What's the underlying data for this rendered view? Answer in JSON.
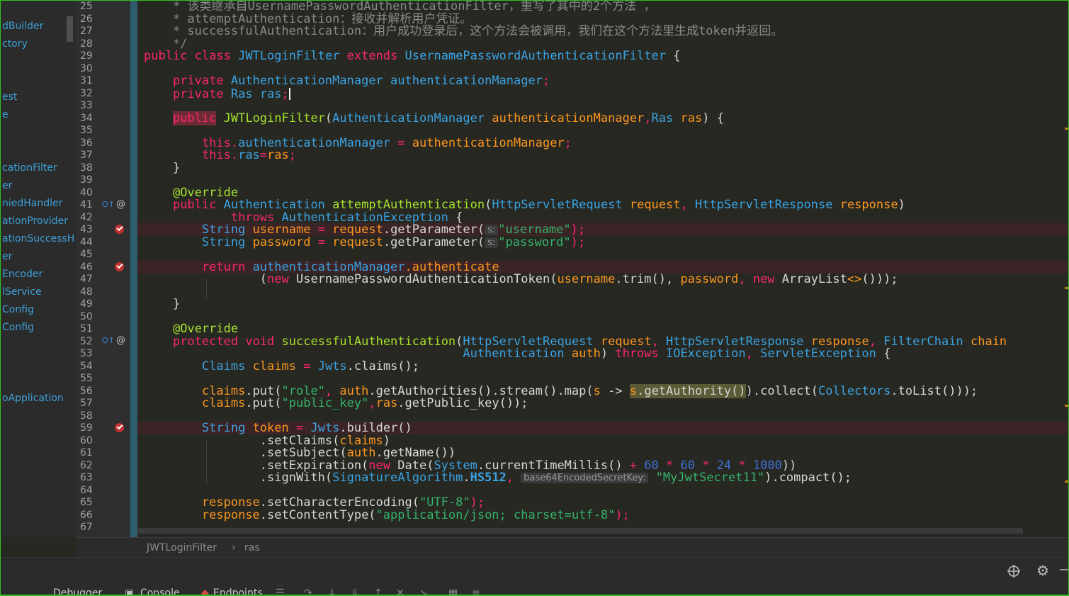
{
  "sidebar": {
    "items": [
      "dBuilder",
      "ctory",
      "est",
      "e",
      "cationFilter",
      "er",
      "niedHandler",
      "ationProvider",
      "ationSuccessH",
      "er",
      "Encoder",
      "lService",
      "Config",
      "Config",
      "oApplication"
    ]
  },
  "gutter": {
    "line_numbers": [
      "25",
      "26",
      "27",
      "28",
      "29",
      "30",
      "31",
      "32",
      "33",
      "34",
      "35",
      "36",
      "37",
      "38",
      "39",
      "40",
      "41",
      "42",
      "43",
      "44",
      "45",
      "46",
      "47",
      "48",
      "49",
      "50",
      "51",
      "52",
      "53",
      "54",
      "55",
      "56",
      "57",
      "58",
      "59",
      "60",
      "61",
      "62",
      "63",
      "64",
      "65",
      "66",
      "67"
    ],
    "icons": [
      "override-icon",
      "annotation-icon",
      "breakpoint-icon",
      "fold-icon"
    ]
  },
  "code": {
    "l25": {
      "a": "*",
      "b": " 该类继承自UsernamePasswordAuthenticationFilter，重写了其中的2个方法 ，"
    },
    "l26": {
      "a": "*",
      "b": " attemptAuthentication：接收并解析用户凭证。"
    },
    "l27": {
      "a": "*",
      "b": " successfulAuthentication：用户成功登录后，这个方法会被调用，我们在这个方法里生成token并返回。"
    },
    "l28": {
      "a": "*/"
    },
    "l29": {
      "a": "public class",
      "b": "JWTLoginFilter",
      "c": "extends",
      "d": "UsernamePasswordAuthenticationFilter",
      "e": "{"
    },
    "l31": {
      "a": "private",
      "b": "AuthenticationManager",
      "c": "authenticationManager",
      "d": ";"
    },
    "l32": {
      "a": "private",
      "b": "Ras",
      "c": "ras",
      "d": ";"
    },
    "l34": {
      "a": "public",
      "b": "JWTLoginFilter",
      "c": "(",
      "d": "AuthenticationManager",
      "e": "authenticationManager",
      "f": ",",
      "g": "Ras",
      "h": "ras",
      "i": ") {"
    },
    "l36": {
      "a": "this.",
      "b": "authenticationManager",
      "c": " = ",
      "d": "authenticationManager",
      "e": ";"
    },
    "l37": {
      "a": "this.",
      "b": "ras",
      "c": "=",
      "d": "ras",
      "e": ";"
    },
    "l38": {
      "a": "}"
    },
    "l40": {
      "a": "@Override"
    },
    "l41": {
      "a": "public",
      "b": "Authentication",
      "c": "attemptAuthentication",
      "d": "(",
      "e": "HttpServletRequest",
      "f": "request",
      "g": ", ",
      "h": "HttpServletResponse",
      "i": "response",
      "j": ")"
    },
    "l42": {
      "a": "throws",
      "b": "AuthenticationException",
      "c": " {"
    },
    "l43": {
      "a": "String",
      "b": "username",
      "c": " = ",
      "d": "request",
      "e": ".getParameter(",
      "hint": "s:",
      "f": "\"username\"",
      "g": ");"
    },
    "l44": {
      "a": "String",
      "b": "password",
      "c": " = ",
      "d": "request",
      "e": ".getParameter(",
      "hint": "s:",
      "f": "\"password\"",
      "g": ");"
    },
    "l46": {
      "a": "return",
      "b": "authenticationManager",
      "c": ".authenticate"
    },
    "l47": {
      "a": "(",
      "b": "new",
      "c": " UsernamePasswordAuthenticationToken(",
      "d": "username",
      "e": ".trim(), ",
      "f": "password",
      "g": ", ",
      "h": "new",
      "i": " ArrayList",
      "j": "<>",
      "k": "()));"
    },
    "l49": {
      "a": "}"
    },
    "l51": {
      "a": "@Override"
    },
    "l52": {
      "a": "protected",
      "b": "void",
      "c": "successfulAuthentication",
      "d": "(",
      "e": "HttpServletRequest",
      "f": "request",
      "g": ", ",
      "h": "HttpServletResponse",
      "i": "response",
      "j": ", ",
      "k": "FilterChain",
      "l": "chain"
    },
    "l53": {
      "a": "Authentication",
      "b": "auth",
      "c": ") ",
      "d": "throws",
      "e": "IOException",
      "f": ", ",
      "g": "ServletException",
      "h": " {"
    },
    "l54": {
      "a": "Claims",
      "b": "claims",
      "c": " = ",
      "d": "Jwts",
      "e": ".claims();"
    },
    "l56": {
      "a": "claims",
      "b": ".put(",
      "c": "\"role\"",
      "d": ", ",
      "e": "auth",
      "f": ".getAuthorities().stream().map(",
      "g": "s",
      "h": " -> ",
      "i": "s",
      "j": ".getAuthority()",
      "k": ").collect(",
      "l": "Collectors",
      "m": ".toList()));"
    },
    "l57": {
      "a": "claims",
      "b": ".put(",
      "c": "\"public_key\"",
      "d": ",",
      "e": "ras",
      "f": ".getPublic_key());"
    },
    "l59": {
      "a": "String",
      "b": "token",
      "c": " = ",
      "d": "Jwts",
      "e": ".builder()"
    },
    "l60": {
      "a": ".setClaims(",
      "b": "claims",
      "c": ")"
    },
    "l61": {
      "a": ".setSubject(",
      "b": "auth",
      "c": ".getName())"
    },
    "l62": {
      "a": ".setExpiration(",
      "b": "new",
      "c": " Date(",
      "d": "System",
      "e": ".currentTimeMillis() ",
      "f": "+",
      "g": " 60 ",
      "h": "*",
      "i": " 60 ",
      "j": "*",
      "k": " 24 ",
      "l": "*",
      "m": " 1000",
      "n": "))"
    },
    "l63": {
      "a": ".signWith(",
      "b": "SignatureAlgorithm",
      "c": ".",
      "d": "HS512",
      "e": ", ",
      "hint": "base64EncodedSecretKey:",
      "f": "\"MyJwtSecret11\"",
      "g": ").compact();"
    },
    "l65": {
      "a": "response",
      "b": ".setCharacterEncoding(",
      "c": "\"UTF-8\"",
      "d": ");"
    },
    "l66": {
      "a": "response",
      "b": ".setContentType(",
      "c": "\"application/json; charset=utf-8\"",
      "d": ");"
    }
  },
  "breadcrumb": {
    "class": "JWTLoginFilter",
    "sep": "›",
    "field": "ras"
  },
  "bottom": {
    "tabs": [
      "Debugger",
      "Console",
      "Endpoints"
    ],
    "icons": [
      "list-icon",
      "step-over-icon",
      "step-into-icon",
      "force-step-into-icon",
      "step-out-icon",
      "drop-frame-icon",
      "run-to-cursor-icon",
      "evaluate-icon",
      "trace-icon"
    ],
    "right_icons": [
      "target-icon",
      "gear-icon",
      "minimize-icon"
    ]
  }
}
